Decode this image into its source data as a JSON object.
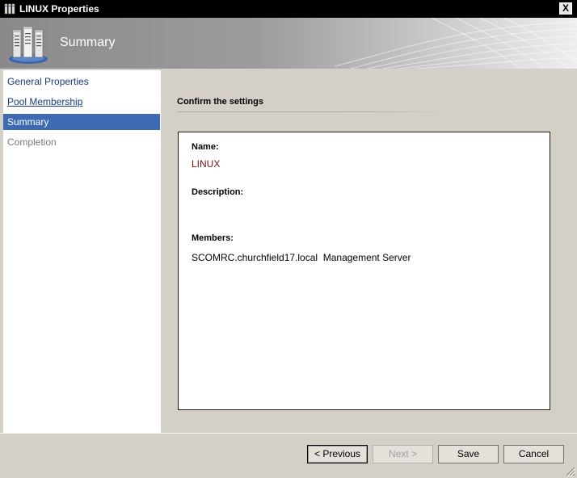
{
  "window": {
    "title": "LINUX Properties",
    "close_label": "X"
  },
  "banner": {
    "title": "Summary"
  },
  "nav": {
    "items": [
      {
        "label": "General Properties",
        "state": "normal"
      },
      {
        "label": "Pool Membership",
        "state": "link"
      },
      {
        "label": "Summary",
        "state": "active"
      },
      {
        "label": "Completion",
        "state": "disabled"
      }
    ]
  },
  "content": {
    "section_title": "Confirm the settings",
    "summary": {
      "name_label": "Name:",
      "name_value": "LINUX",
      "description_label": "Description:",
      "description_value": "",
      "members_label": "Members:",
      "members_value": "SCOMRC.churchfield17.local  Management Server"
    }
  },
  "buttons": {
    "previous": "< Previous",
    "next": "Next >",
    "save": "Save",
    "cancel": "Cancel"
  },
  "colors": {
    "title_bar": "#000000",
    "nav_active": "#3d6ab3",
    "link": "#1a3a7e",
    "value_text": "#7a1010",
    "dialog_bg": "#d4d0c8"
  }
}
